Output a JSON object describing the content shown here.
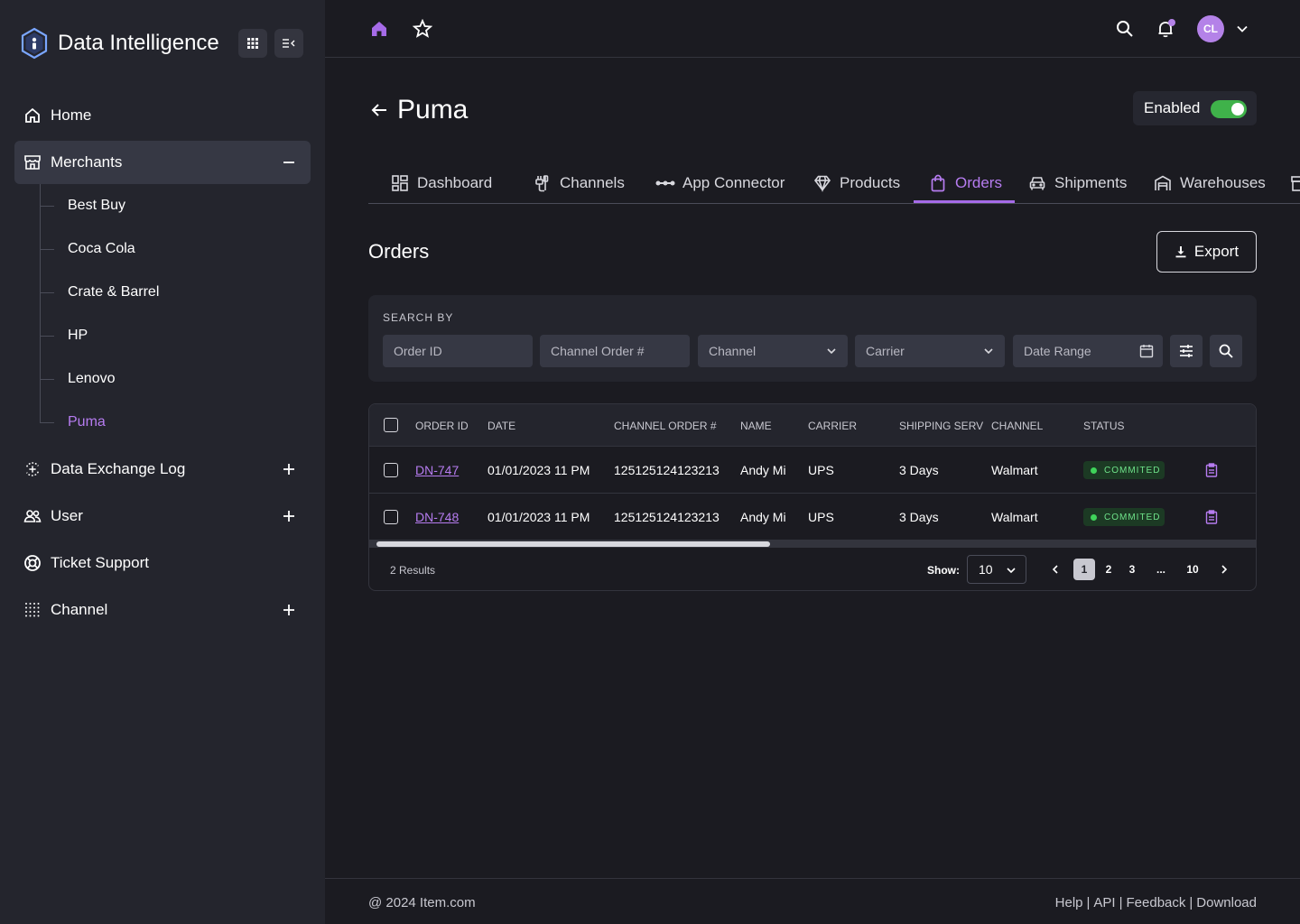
{
  "brand": {
    "name": "Data Intelligence"
  },
  "sidebar": {
    "items": [
      {
        "label": "Home",
        "icon": "home-icon"
      },
      {
        "label": "Merchants",
        "icon": "store-icon",
        "toggle": "minus"
      },
      {
        "label": "Data Exchange Log",
        "icon": "exchange-icon",
        "toggle": "plus"
      },
      {
        "label": "User",
        "icon": "users-icon",
        "toggle": "plus"
      },
      {
        "label": "Ticket Support",
        "icon": "lifebuoy-icon"
      },
      {
        "label": "Channel",
        "icon": "dots-grid-icon",
        "toggle": "plus"
      }
    ],
    "merchants": [
      "Best Buy",
      "Coca Cola",
      "Crate & Barrel",
      "HP",
      "Lenovo",
      "Puma"
    ],
    "active_merchant": "Puma"
  },
  "topbar": {
    "avatar_initials": "CL"
  },
  "page": {
    "title": "Puma",
    "enabled_label": "Enabled",
    "enabled": true
  },
  "tabs": [
    {
      "label": "Dashboard"
    },
    {
      "label": "Channels"
    },
    {
      "label": "App Connector"
    },
    {
      "label": "Products"
    },
    {
      "label": "Orders",
      "active": true
    },
    {
      "label": "Shipments"
    },
    {
      "label": "Warehouses"
    }
  ],
  "orders": {
    "title": "Orders",
    "export_label": "Export",
    "search": {
      "label": "SEARCH BY",
      "order_id_placeholder": "Order ID",
      "channel_order_placeholder": "Channel Order #",
      "channel_label": "Channel",
      "carrier_label": "Carrier",
      "date_range_label": "Date Range"
    },
    "columns": [
      "ORDER ID",
      "DATE",
      "CHANNEL ORDER #",
      "NAME",
      "CARRIER",
      "SHIPPING SERV",
      "CHANNEL",
      "STATUS"
    ],
    "rows": [
      {
        "order_id": "DN-747",
        "date": "01/01/2023 11 PM",
        "channel_order": "125125124123213",
        "name": "Andy Mi",
        "carrier": "UPS",
        "shipping": "3 Days",
        "channel": "Walmart",
        "status": "COMMITED"
      },
      {
        "order_id": "DN-748",
        "date": "01/01/2023 11 PM",
        "channel_order": "125125124123213",
        "name": "Andy Mi",
        "carrier": "UPS",
        "shipping": "3 Days",
        "channel": "Walmart",
        "status": "COMMITED"
      }
    ],
    "results": "2 Results",
    "show_label": "Show:",
    "show_value": "10",
    "pages": [
      "1",
      "2",
      "3",
      "...",
      "10"
    ],
    "current_page": "1"
  },
  "footer": {
    "copyright": "@ 2024 Item.com",
    "links": [
      "Help",
      "API",
      "Feedback",
      "Download"
    ]
  },
  "colors": {
    "accent": "#b67cf0",
    "toggle_on": "#3fb24a",
    "status_green": "#3fd35a"
  }
}
